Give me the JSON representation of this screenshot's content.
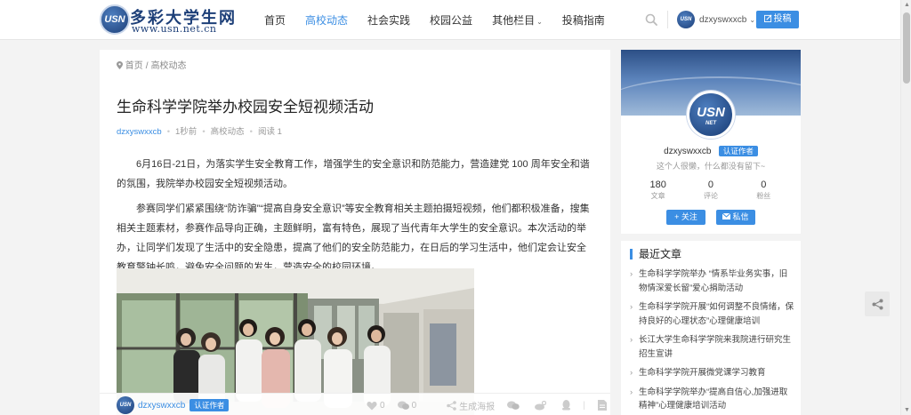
{
  "site": {
    "logo_badge": "USN",
    "name": "多彩大学生网",
    "url_text": "www.usn.net.cn"
  },
  "nav": {
    "items": [
      {
        "label": "首页",
        "active": false
      },
      {
        "label": "高校动态",
        "active": true
      },
      {
        "label": "社会实践",
        "active": false
      },
      {
        "label": "校园公益",
        "active": false
      },
      {
        "label": "其他栏目",
        "active": false,
        "dropdown": true
      },
      {
        "label": "投稿指南",
        "active": false
      }
    ]
  },
  "header": {
    "username": "dzxyswxxcb",
    "post_button": "投稿",
    "search_icon": "search-icon"
  },
  "breadcrumb": {
    "home": "首页",
    "separator": "/",
    "current": "高校动态"
  },
  "article": {
    "title": "生命科学学院举办校园安全短视频活动",
    "meta": {
      "author": "dzxyswxxcb",
      "time": "1秒前",
      "category": "高校动态",
      "reads": "阅读 1"
    },
    "paragraphs": [
      "6月16日-21日，为落实学生安全教育工作，增强学生的安全意识和防范能力，营造建党 100 周年安全和谐的氛围，我院举办校园安全短视频活动。",
      "参赛同学们紧紧围绕“防诈骗”“提高自身安全意识”等安全教育相关主题拍摄短视频，他们都积极准备，搜集相关主题素材，参赛作品导向正确，主题鲜明，富有特色，展现了当代青年大学生的安全意识。本次活动的举办，让同学们发现了生活中的安全隐患，提高了他们的安全防范能力，在日后的学习生活中，他们定会让安全教育警钟长鸣，避免安全问题的发生，营造安全的校园环境。"
    ]
  },
  "bottom_bar": {
    "author": "dzxyswxxcb",
    "badge": "认证作者",
    "likes": "0",
    "comments": "0",
    "poster": "生成海报"
  },
  "profile": {
    "name": "dzxyswxxcb",
    "badge": "认证作者",
    "bio": "这个人很懒，什么都没有留下~",
    "avatar_text": "USN",
    "avatar_sub": "NET",
    "stats": [
      {
        "num": "180",
        "label": "文章"
      },
      {
        "num": "0",
        "label": "评论"
      },
      {
        "num": "0",
        "label": "粉丝"
      }
    ],
    "follow_button": "+ 关注",
    "message_button": "私信"
  },
  "recent": {
    "title": "最近文章",
    "items": [
      "生命科学学院举办 “情系毕业务实事，旧物情深爱长留”爱心捐助活动",
      "生命科学学院开展“如何调整不良情绪，保持良好的心理状态”心理健康培训",
      "长江大学生命科学学院来我院进行研究生招生宣讲",
      "生命科学学院开展微党课学习教育",
      "生命科学学院举办“提高自信心,加强进取精神”心理健康培训活动"
    ]
  },
  "colors": {
    "accent": "#3b8ee3",
    "brand": "#1d3f78"
  }
}
